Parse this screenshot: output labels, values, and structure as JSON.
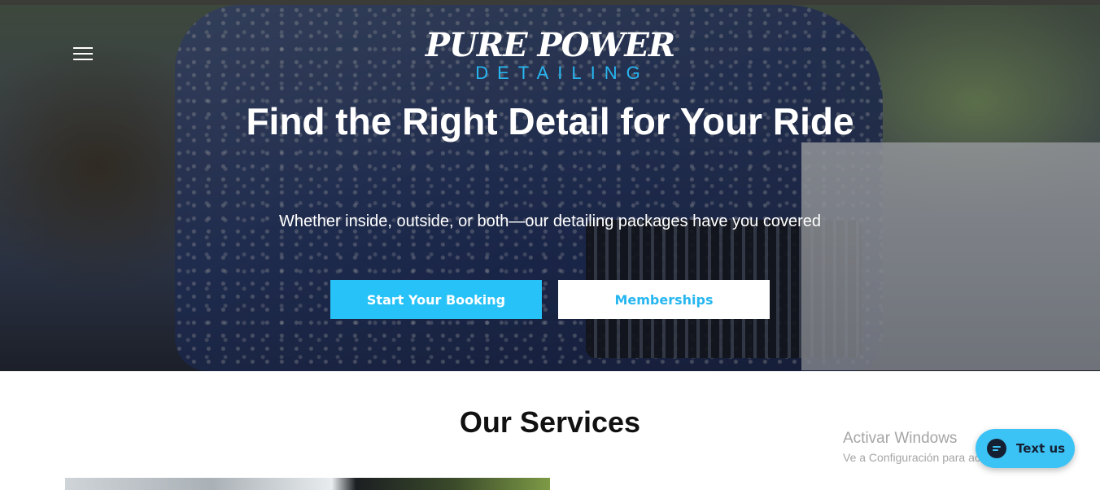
{
  "brand": {
    "logo_main": "PURE POWER",
    "logo_sub": "DETAILING",
    "accent_color": "#27c2f7"
  },
  "nav": {
    "menu_icon": "hamburger-menu-icon"
  },
  "hero": {
    "title": "Find the Right Detail for Your Ride",
    "subtitle": "Whether inside, outside, or both—our detailing packages have you covered",
    "primary_button": "Start Your Booking",
    "secondary_button": "Memberships"
  },
  "services": {
    "title": "Our Services"
  },
  "watermark": {
    "title": "Activar Windows",
    "subtitle": "Ve a Configuración para activar Windows."
  },
  "chat": {
    "icon": "chat-bubble-icon",
    "label": "Text us"
  }
}
